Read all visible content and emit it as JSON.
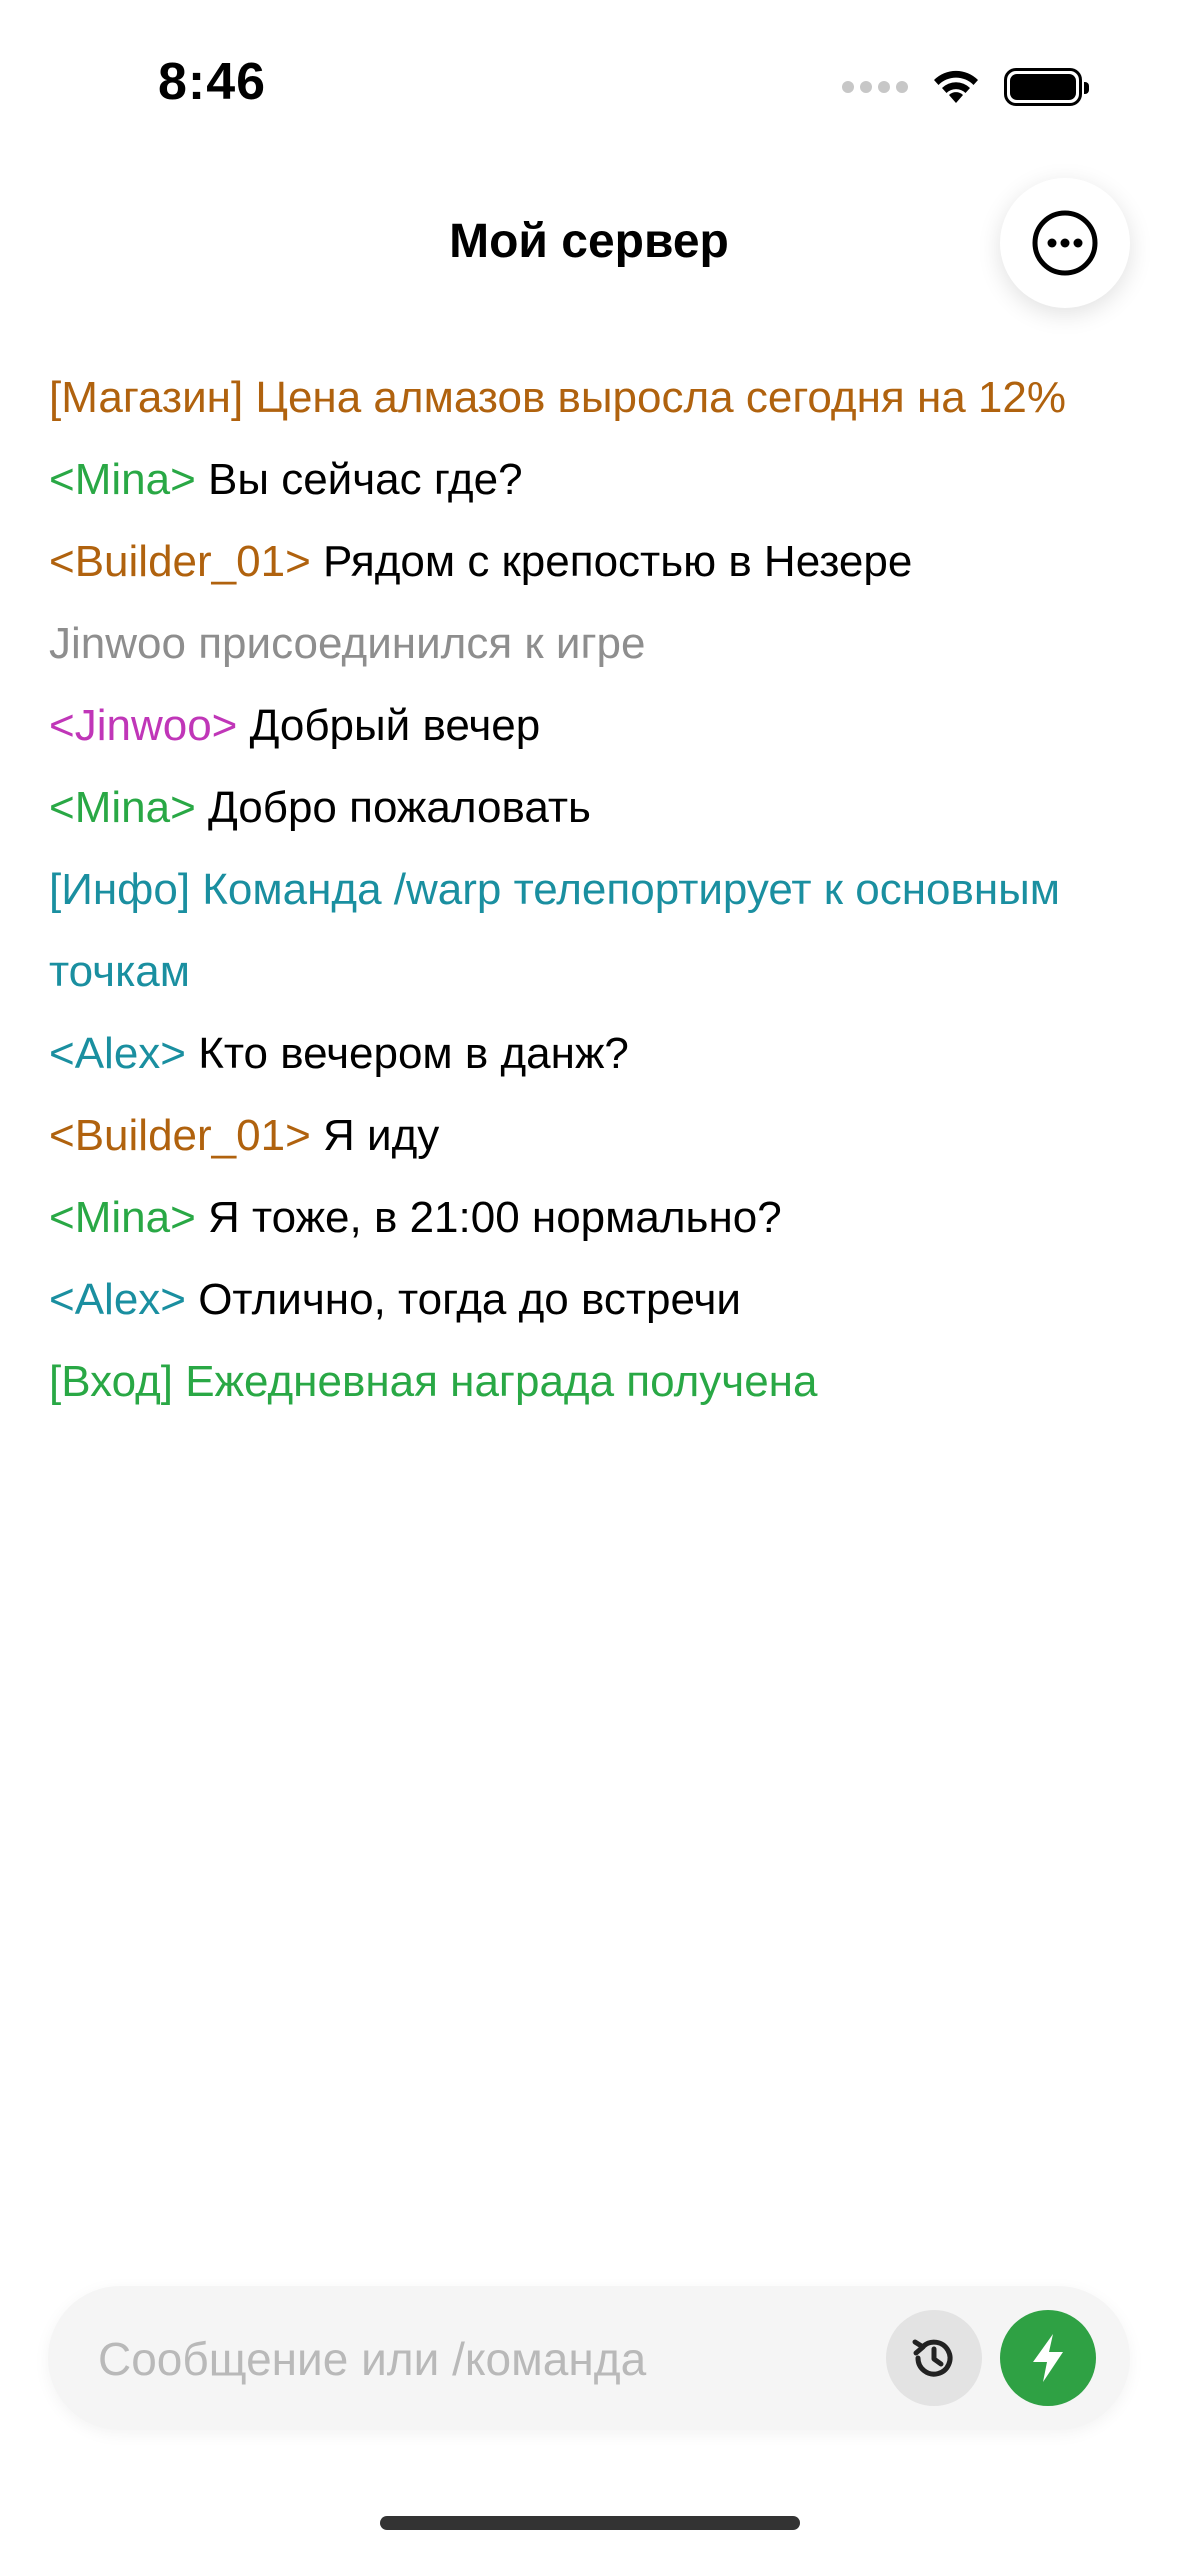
{
  "status_bar": {
    "time": "8:46",
    "signal_icon": "signal-dots-icon",
    "wifi_icon": "wifi-icon",
    "battery_icon": "battery-icon"
  },
  "header": {
    "title": "Мой сервер",
    "more_icon": "ellipsis-circle-icon"
  },
  "chat": {
    "messages": [
      {
        "prefix": "[Магазин]",
        "text": " Цена алмазов выросла сегодня на 12%",
        "prefix_color": "#b0620e",
        "text_color": "#b0620e"
      },
      {
        "prefix": "<Mina>",
        "text": " Вы сейчас где?",
        "prefix_color": "#29a845",
        "text_color": "#000000"
      },
      {
        "prefix": "<Builder_01>",
        "text": " Рядом с крепостью в Незере",
        "prefix_color": "#b0620e",
        "text_color": "#000000"
      },
      {
        "prefix": "",
        "text": "Jinwoo присоединился к игре",
        "prefix_color": "#8e8e8e",
        "text_color": "#8e8e8e"
      },
      {
        "prefix": "<Jinwoo>",
        "text": " Добрый вечер",
        "prefix_color": "#c036b8",
        "text_color": "#000000"
      },
      {
        "prefix": "<Mina>",
        "text": " Добро пожаловать",
        "prefix_color": "#29a845",
        "text_color": "#000000"
      },
      {
        "prefix": "[Инфо]",
        "text": " Команда /warp телепортирует к основным точкам",
        "prefix_color": "#1a8fa0",
        "text_color": "#1a8fa0"
      },
      {
        "prefix": "<Alex>",
        "text": " Кто вечером в данж?",
        "prefix_color": "#1a8fa0",
        "text_color": "#000000"
      },
      {
        "prefix": "<Builder_01>",
        "text": " Я иду",
        "prefix_color": "#b0620e",
        "text_color": "#000000"
      },
      {
        "prefix": "<Mina>",
        "text": " Я тоже, в 21:00 нормально?",
        "prefix_color": "#29a845",
        "text_color": "#000000"
      },
      {
        "prefix": "<Alex>",
        "text": " Отлично, тогда до встречи",
        "prefix_color": "#1a8fa0",
        "text_color": "#000000"
      },
      {
        "prefix": "[Вход]",
        "text": " Ежедневная награда получена",
        "prefix_color": "#29a845",
        "text_color": "#29a845"
      }
    ]
  },
  "input": {
    "value": "",
    "placeholder": "Сообщение или /команда",
    "history_icon": "history-icon",
    "send_icon": "lightning-bolt-icon"
  },
  "colors": {
    "accent_green": "#2fa144",
    "background": "#ffffff"
  }
}
